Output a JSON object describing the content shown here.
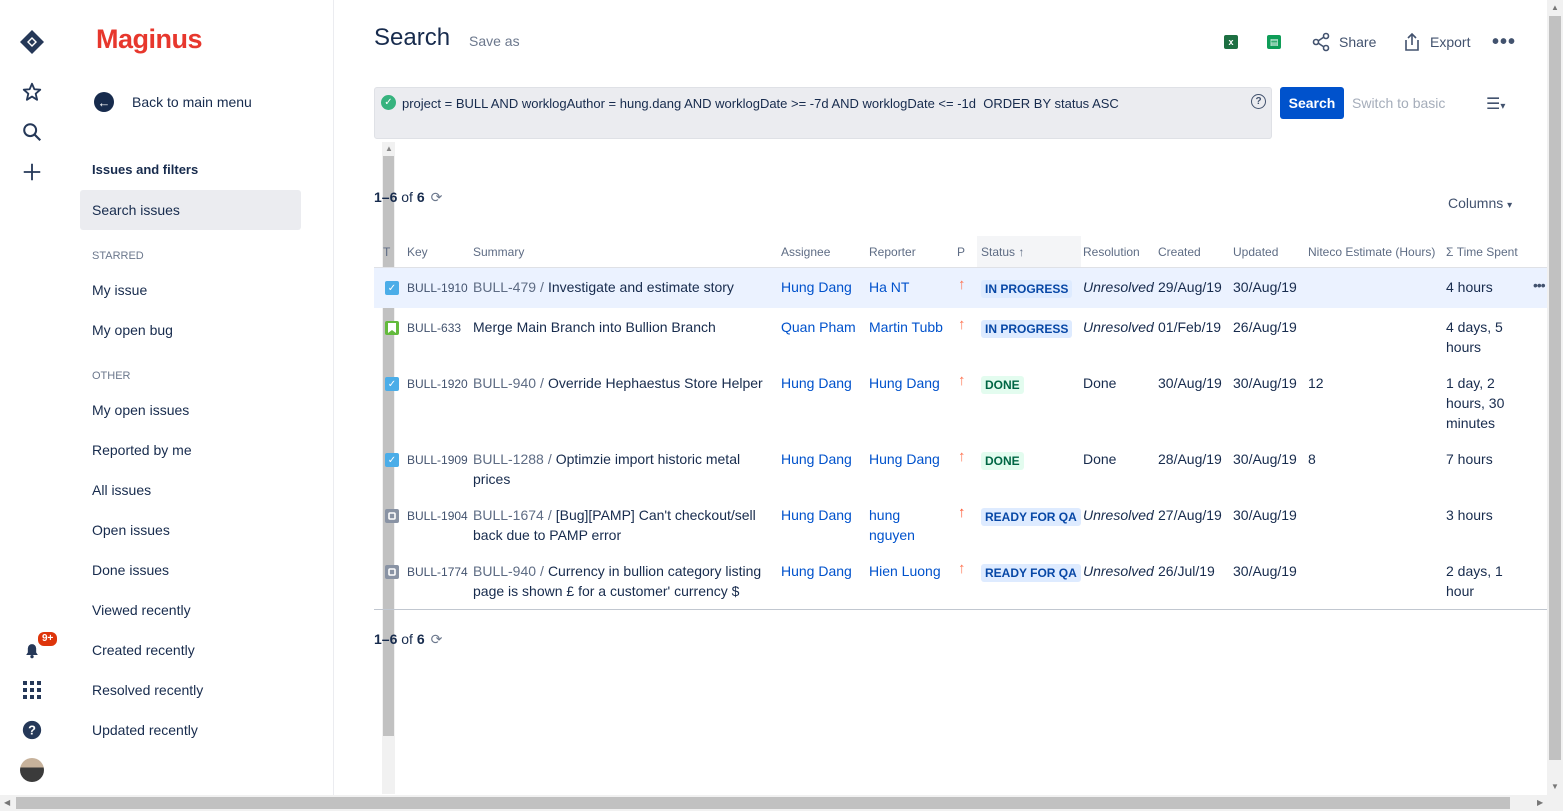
{
  "app": {
    "logo": "Maginus"
  },
  "global_nav": {
    "notification_badge": "9+"
  },
  "sidebar": {
    "back_label": "Back to main menu",
    "section_title": "Issues and filters",
    "search_issues": "Search issues",
    "starred_header": "STARRED",
    "starred": [
      "My issue",
      "My open bug"
    ],
    "other_header": "OTHER",
    "other": [
      "My open issues",
      "Reported by me",
      "All issues",
      "Open issues",
      "Done issues",
      "Viewed recently",
      "Created recently",
      "Resolved recently",
      "Updated recently"
    ]
  },
  "header": {
    "title": "Search",
    "save_as": "Save as",
    "share": "Share",
    "export": "Export"
  },
  "search": {
    "jql": "project = BULL AND worklogAuthor = hung.dang AND worklogDate >= -7d AND worklogDate <= -1d  ORDER BY status ASC",
    "button": "Search",
    "switch_basic": "Switch to basic"
  },
  "results": {
    "range": "1–6",
    "of": "of",
    "total": "6",
    "columns_label": "Columns"
  },
  "table": {
    "headers": {
      "type": "T",
      "key": "Key",
      "summary": "Summary",
      "assignee": "Assignee",
      "reporter": "Reporter",
      "priority": "P",
      "status": "Status",
      "resolution": "Resolution",
      "created": "Created",
      "updated": "Updated",
      "estimate": "Niteco Estimate (Hours)",
      "time_spent": "Σ Time Spent"
    },
    "rows": [
      {
        "type": "subtask-check",
        "key": "BULL-1910",
        "parent": "BULL-479",
        "summary": "Investigate and estimate story",
        "assignee": "Hung Dang",
        "reporter": "Ha NT",
        "status": "IN PROGRESS",
        "resolution": "Unresolved",
        "created": "29/Aug/19",
        "updated": "30/Aug/19",
        "estimate": "",
        "time_spent": "4 hours"
      },
      {
        "type": "story",
        "key": "BULL-633",
        "parent": "",
        "summary": "Merge Main Branch into Bullion Branch",
        "assignee": "Quan Pham",
        "reporter": "Martin Tubb",
        "status": "IN PROGRESS",
        "resolution": "Unresolved",
        "created": "01/Feb/19",
        "updated": "26/Aug/19",
        "estimate": "",
        "time_spent": "4 days, 5 hours"
      },
      {
        "type": "subtask-check",
        "key": "BULL-1920",
        "parent": "BULL-940",
        "summary": "Override Hephaestus Store Helper",
        "assignee": "Hung Dang",
        "reporter": "Hung Dang",
        "status": "DONE",
        "resolution": "Done",
        "created": "30/Aug/19",
        "updated": "30/Aug/19",
        "estimate": "12",
        "time_spent": "1 day, 2 hours, 30 minutes"
      },
      {
        "type": "subtask-check",
        "key": "BULL-1909",
        "parent": "BULL-1288",
        "summary": "Optimzie import historic metal prices",
        "assignee": "Hung Dang",
        "reporter": "Hung Dang",
        "status": "DONE",
        "resolution": "Done",
        "created": "28/Aug/19",
        "updated": "30/Aug/19",
        "estimate": "8",
        "time_spent": "7 hours"
      },
      {
        "type": "subtask",
        "key": "BULL-1904",
        "parent": "BULL-1674",
        "summary": "[Bug][PAMP] Can't checkout/sell back due to PAMP error",
        "assignee": "Hung Dang",
        "reporter": "hung nguyen",
        "status": "READY FOR QA",
        "resolution": "Unresolved",
        "created": "27/Aug/19",
        "updated": "30/Aug/19",
        "estimate": "",
        "time_spent": "3 hours"
      },
      {
        "type": "subtask",
        "key": "BULL-1774",
        "parent": "BULL-940",
        "summary": "Currency in bullion category listing page is shown £ for a customer' currency $",
        "assignee": "Hung Dang",
        "reporter": "Hien Luong",
        "status": "READY FOR QA",
        "resolution": "Unresolved",
        "created": "26/Jul/19",
        "updated": "30/Aug/19",
        "estimate": "",
        "time_spent": "2 days, 1 hour"
      }
    ]
  },
  "colors": {
    "brand": "#e7372d",
    "primary": "#0052cc",
    "priority_high": "#ff7452",
    "priority_highest": "#ff5630"
  }
}
